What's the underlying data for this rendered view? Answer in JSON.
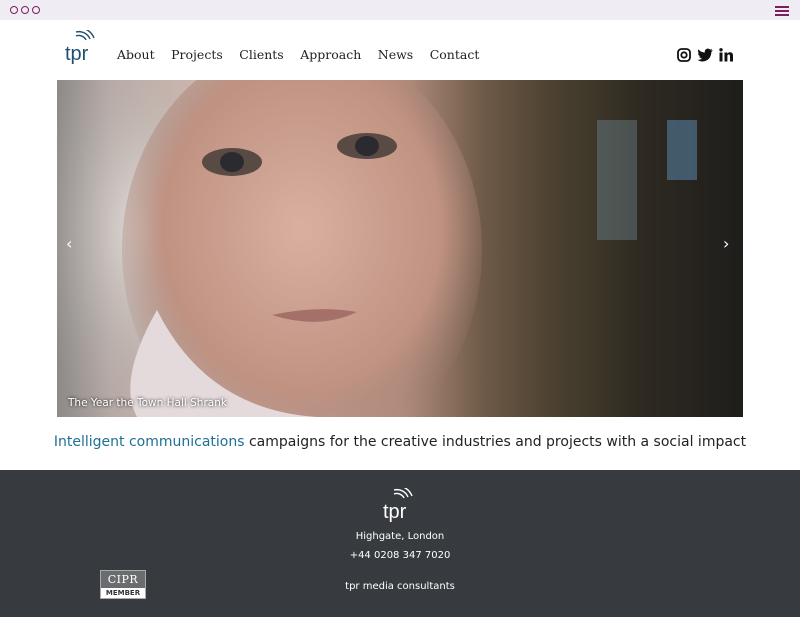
{
  "window": {
    "menu_icon": "hamburger-icon"
  },
  "header": {
    "logo_text": "tpr",
    "nav": [
      "About",
      "Projects",
      "Clients",
      "Approach",
      "News",
      "Contact"
    ],
    "social": [
      "instagram-icon",
      "twitter-icon",
      "linkedin-icon"
    ]
  },
  "hero": {
    "caption": "The Year the Town Hall Shrank",
    "prev_arrow": "‹",
    "next_arrow": "›"
  },
  "tagline": {
    "accent": "Intelligent communications",
    "rest": " campaigns for the creative industries and projects with a social impact"
  },
  "footer": {
    "logo_text": "tpr",
    "address": "Highgate, London",
    "phone": "+44 0208 347 7020",
    "name": "tpr media consultants",
    "badge_top": "CIPR",
    "badge_bottom": "MEMBER"
  },
  "colors": {
    "accent": "#1f6f96",
    "chrome_accent": "#7a1f5c",
    "footer_bg": "#373b40"
  }
}
